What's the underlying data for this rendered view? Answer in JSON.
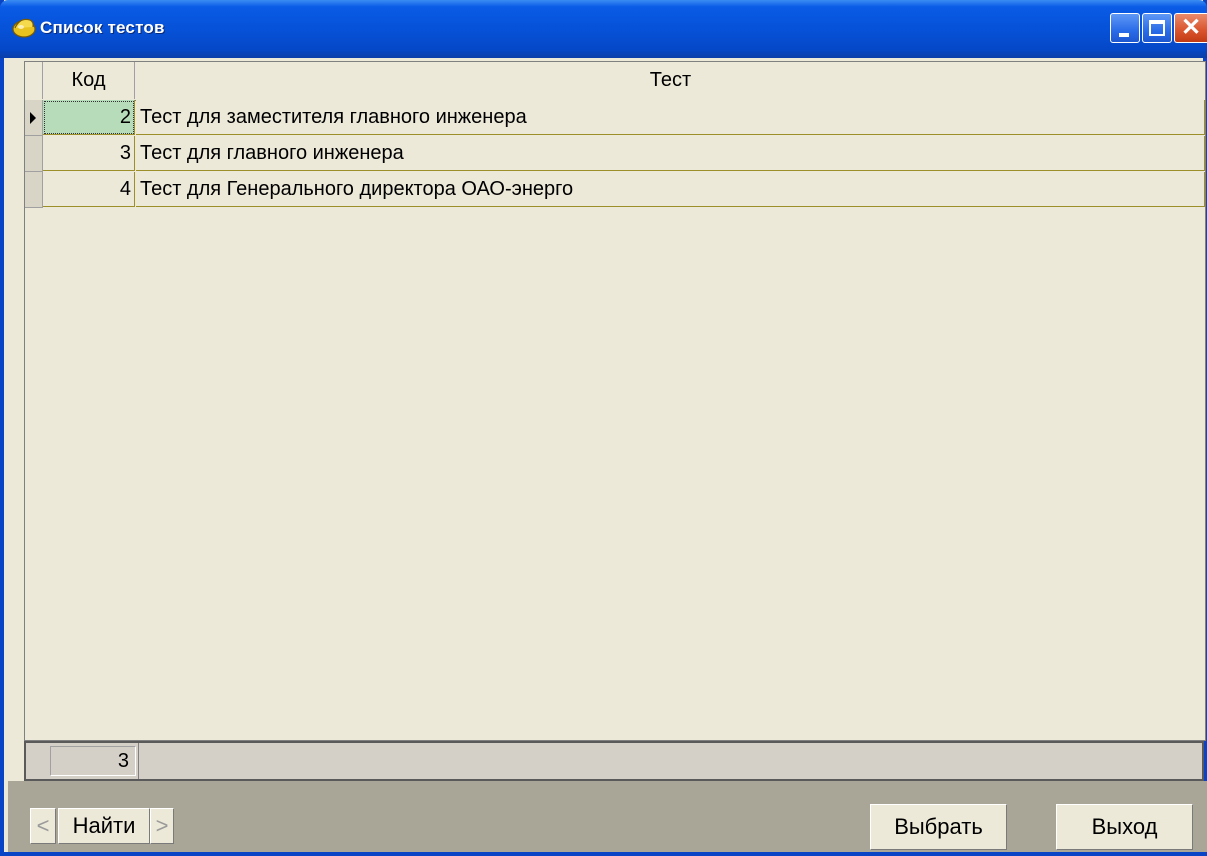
{
  "window": {
    "title": "Список тестов"
  },
  "grid": {
    "columns": [
      {
        "label": "Код"
      },
      {
        "label": "Тест"
      }
    ],
    "rows": [
      {
        "code": "2",
        "name": "Тест для заместителя главного инженера"
      },
      {
        "code": "3",
        "name": "Тест для главного инженера"
      },
      {
        "code": "4",
        "name": "Тест для Генерального директора ОАО-энерго"
      }
    ],
    "selected_row": 0
  },
  "footer": {
    "count": "3"
  },
  "toolbar": {
    "prev_label": "<",
    "find_label": "Найти",
    "next_label": ">",
    "choose_label": "Выбрать",
    "exit_label": "Выход"
  }
}
